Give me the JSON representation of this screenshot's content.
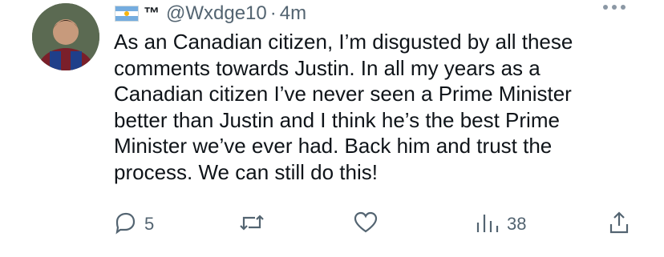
{
  "tweet": {
    "header": {
      "flag": "argentina-flag-icon",
      "tm": "™",
      "handle": "@Wxdge10",
      "separator": "·",
      "time": "4m"
    },
    "text": "As an Canadian citizen, I’m disgusted by all these\ncomments towards Justin. In all my years as a\nCanadian citizen I’ve never seen a Prime Minister\nbetter than Justin and I think he’s the best Prime\nMinister we’ve ever had. Back him and trust the\nprocess. We can still do this!",
    "actions": {
      "reply_count": "5",
      "retweet_count": "",
      "like_count": "",
      "views_count": "38"
    }
  },
  "colors": {
    "text": "#0f1419",
    "muted": "#536471"
  },
  "icons": [
    "more-icon",
    "reply-icon",
    "retweet-icon",
    "like-icon",
    "views-icon",
    "share-icon"
  ]
}
